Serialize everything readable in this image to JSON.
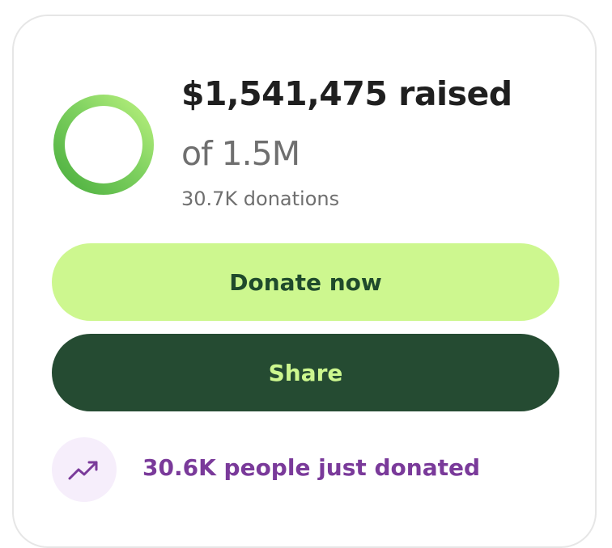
{
  "summary": {
    "raised_text": "$1,541,475 raised",
    "goal_text": "of 1.5M",
    "donations_text": "30.7K donations",
    "progress_fraction": 1.0
  },
  "actions": {
    "donate_label": "Donate now",
    "share_label": "Share"
  },
  "activity": {
    "icon": "trending-up-icon",
    "text": "30.6K people just donated"
  },
  "colors": {
    "ring_dark": "#4caf3f",
    "ring_light": "#b8f07d",
    "donate_bg": "#cdf78f",
    "share_bg": "#254b32",
    "activity_text": "#7a3a9a",
    "activity_badge_bg": "#f6eefb"
  }
}
